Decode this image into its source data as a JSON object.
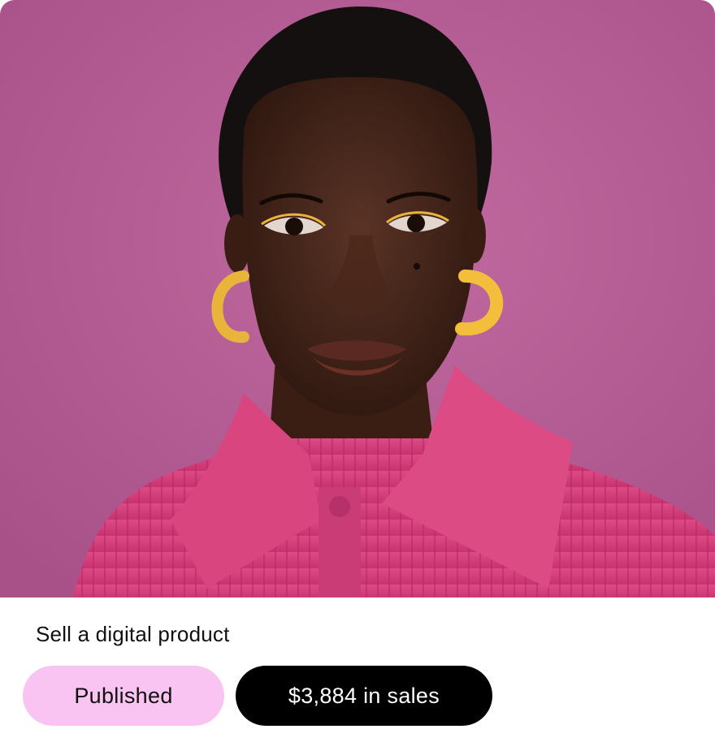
{
  "card": {
    "title": "Sell a digital product",
    "status_label": "Published",
    "sales_label": "$3,884 in sales"
  },
  "colors": {
    "backdrop": "#b45f95",
    "sweater": "#d63f7c",
    "status_pill": "#f9c3f2",
    "sales_pill": "#000000"
  },
  "image": {
    "subject": "portrait-photo"
  }
}
